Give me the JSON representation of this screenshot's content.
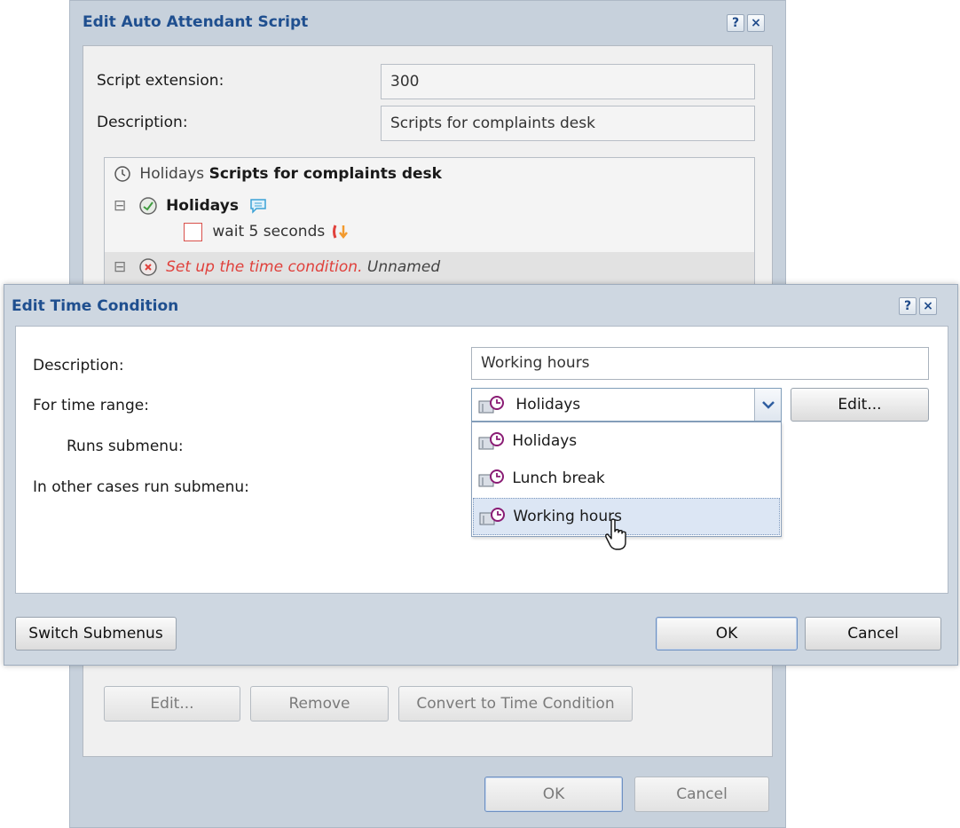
{
  "back_dialog": {
    "title": "Edit Auto Attendant Script",
    "help_label": "?",
    "close_label": "×",
    "extension_label": "Script extension:",
    "extension_value": "300",
    "description_label": "Description:",
    "description_value": "Scripts for complaints desk",
    "tree": {
      "root_prefix": "Holidays",
      "root_bold": "Scripts for complaints desk",
      "toggle": "⊟",
      "node1_label": "Holidays",
      "node1_child": "wait 5 seconds",
      "node2_error": "Set up the time condition.",
      "node2_name": "Unnamed"
    },
    "edit_button": "Edit...",
    "remove_button": "Remove",
    "convert_button": "Convert to Time Condition",
    "ok_button": "OK",
    "cancel_button": "Cancel"
  },
  "front_dialog": {
    "title": "Edit Time Condition",
    "help_label": "?",
    "close_label": "×",
    "description_label": "Description:",
    "description_value": "Working hours",
    "time_range_label": "For time range:",
    "time_range_selected": "Holidays",
    "runs_submenu_label": "Runs submenu:",
    "other_cases_label": "In other cases run submenu:",
    "edit_button": "Edit...",
    "dropdown_options": [
      "Holidays",
      "Lunch break",
      "Working hours"
    ],
    "switch_button": "Switch Submenus",
    "ok_button": "OK",
    "cancel_button": "Cancel"
  },
  "colors": {
    "title_text": "#1f4f8f",
    "error_text": "#e0413c",
    "highlight": "#dce6f4",
    "dropdown_border": "#7f9db9"
  }
}
